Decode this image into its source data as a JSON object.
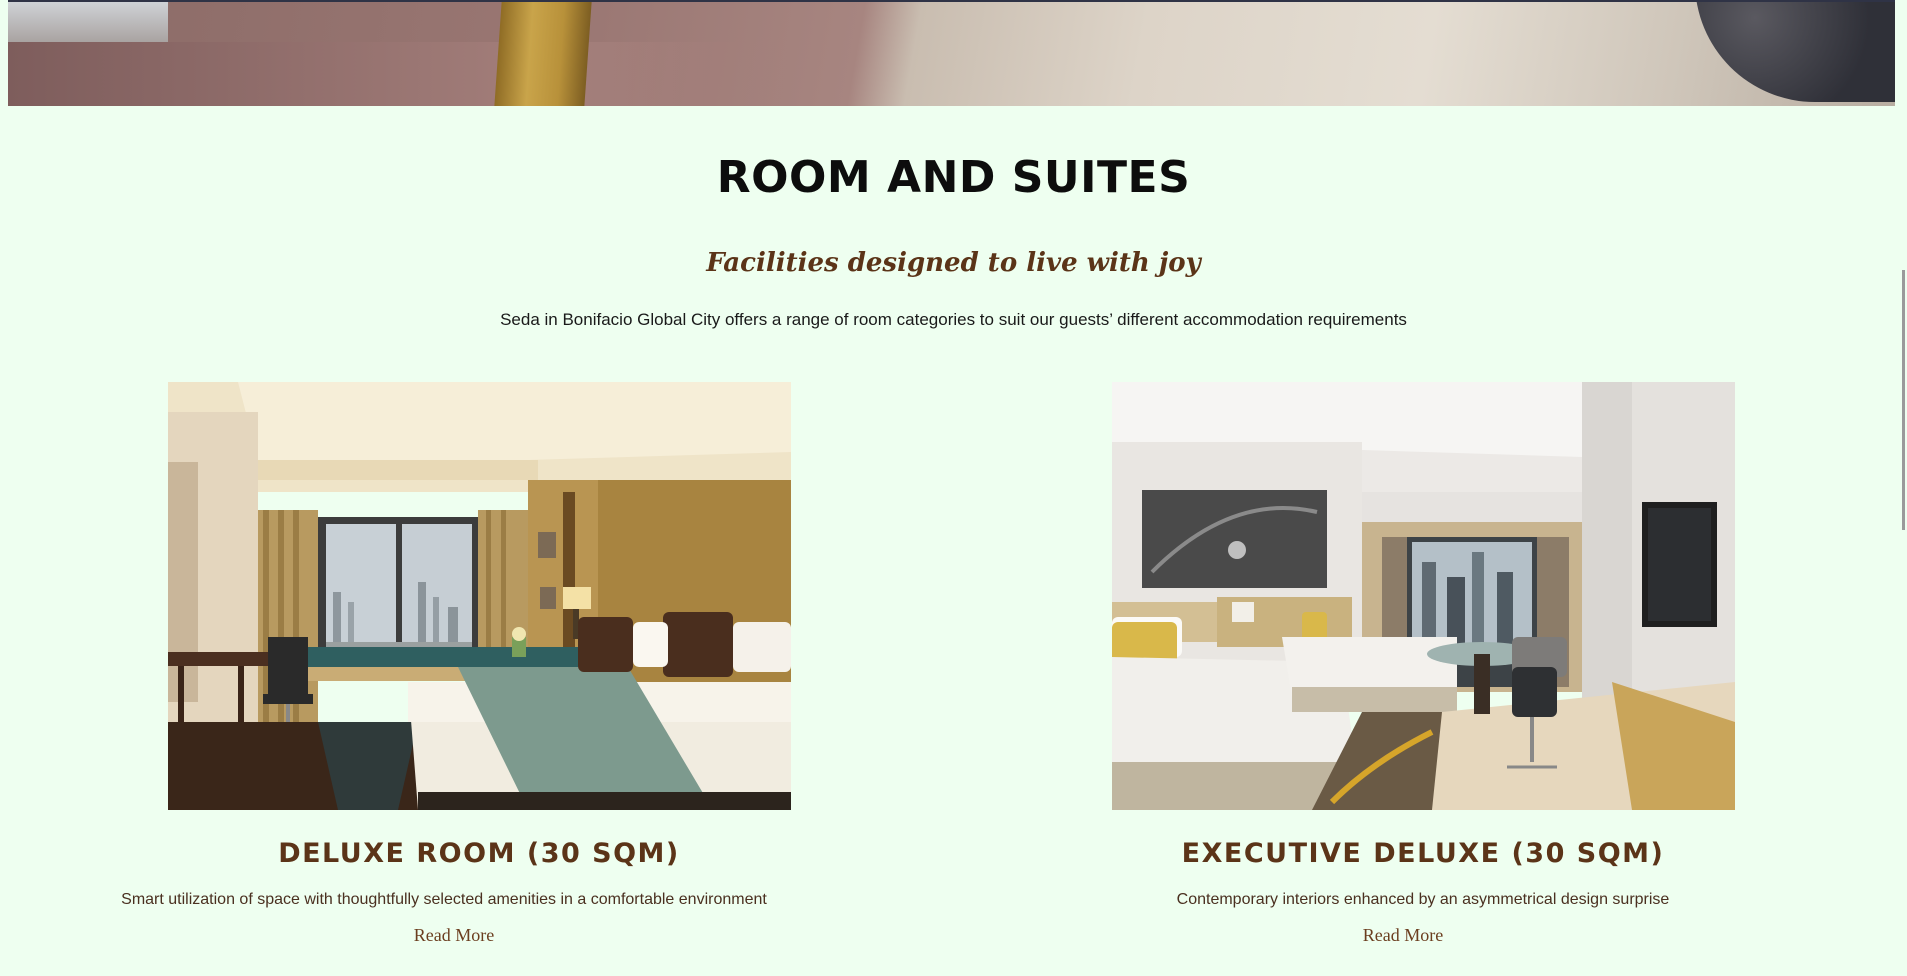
{
  "section": {
    "heading": "ROOM AND SUITES",
    "tagline": "Facilities designed to live with joy",
    "intro": "Seda in Bonifacio Global City offers a range of room categories to suit our guests’ different accommodation requirements"
  },
  "rooms": [
    {
      "title": "DELUXE ROOM (30 SQM)",
      "description": "Smart utilization of space with thoughtfully selected amenities in a comfortable environment",
      "link": "Read More"
    },
    {
      "title": "EXECUTIVE DELUXE (30 SQM)",
      "description": "Contemporary interiors enhanced by an asymmetrical design surprise",
      "link": "Read More"
    }
  ],
  "colors": {
    "background": "#eefff0",
    "accent_brown": "#5b3418",
    "heading": "#0d0d0d"
  }
}
